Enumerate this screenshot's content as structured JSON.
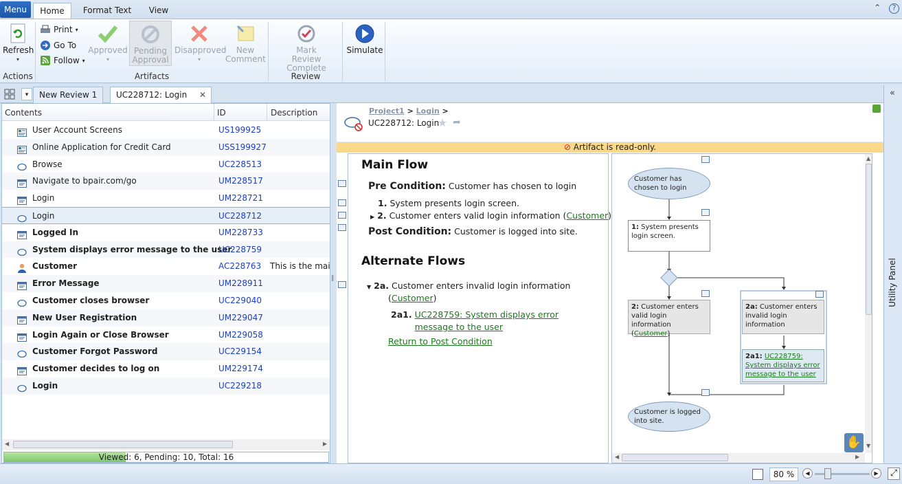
{
  "ribbon": {
    "menu_label": "Menu",
    "tabs": [
      "Home",
      "Format Text",
      "View"
    ],
    "actions": {
      "refresh": "Refresh",
      "group_label": "Actions"
    },
    "artifacts": {
      "print": "Print",
      "goto": "Go To",
      "follow": "Follow",
      "approved": "Approved",
      "pending_1": "Pending",
      "pending_2": "Approval",
      "disapproved": "Disapproved",
      "new_1": "New",
      "new_2": "Comment",
      "group_label": "Artifacts"
    },
    "review": {
      "mark_1": "Mark",
      "mark_2": "Review Complete",
      "group_label": "Review"
    },
    "simulate": "Simulate"
  },
  "doc_tabs": [
    {
      "label": "New Review 1"
    },
    {
      "label": "UC228712: Login"
    }
  ],
  "grid": {
    "headers": [
      "Contents",
      "ID",
      "Description"
    ],
    "rows": [
      {
        "icon": "storyboard-icon",
        "name": "User Account Screens",
        "id": "US199925",
        "desc": "",
        "bold": false
      },
      {
        "icon": "storyboard-icon",
        "name": "Online Application for Credit Card",
        "id": "USS199927",
        "desc": "",
        "bold": false
      },
      {
        "icon": "usecase-icon",
        "name": "Browse",
        "id": "UC228513",
        "desc": "",
        "bold": false
      },
      {
        "icon": "screen-icon",
        "name": "Navigate to bpair.com/go",
        "id": "UM228517",
        "desc": "",
        "bold": false
      },
      {
        "icon": "screen-icon",
        "name": "Login",
        "id": "UM228721",
        "desc": "",
        "bold": false
      },
      {
        "icon": "usecase-icon",
        "name": "Login",
        "id": "UC228712",
        "desc": "",
        "bold": false,
        "selected": true
      },
      {
        "icon": "screen-icon",
        "name": "Logged In",
        "id": "UM228733",
        "desc": "",
        "bold": true
      },
      {
        "icon": "usecase-icon",
        "name": "System displays error message to the user",
        "id": "UC228759",
        "desc": "",
        "bold": true
      },
      {
        "icon": "actor-icon",
        "name": "Customer",
        "id": "AC228763",
        "desc": "This is the main",
        "bold": true
      },
      {
        "icon": "screen-icon",
        "name": "Error Message",
        "id": "UM228911",
        "desc": "",
        "bold": true
      },
      {
        "icon": "usecase-icon",
        "name": "Customer closes browser",
        "id": "UC229040",
        "desc": "",
        "bold": true
      },
      {
        "icon": "screen-icon",
        "name": "New User Registration",
        "id": "UM229047",
        "desc": "",
        "bold": true
      },
      {
        "icon": "screen-icon",
        "name": "Login Again or Close Browser",
        "id": "UM229058",
        "desc": "",
        "bold": true
      },
      {
        "icon": "usecase-icon",
        "name": "Customer Forgot Password",
        "id": "UC229154",
        "desc": "",
        "bold": true
      },
      {
        "icon": "screen-icon",
        "name": "Customer decides to log on",
        "id": "UM229174",
        "desc": "",
        "bold": true
      },
      {
        "icon": "usecase-icon",
        "name": "Login",
        "id": "UC229218",
        "desc": "",
        "bold": true
      }
    ],
    "status": "Viewed: 6, Pending: 10, Total: 16",
    "viewed_fraction": 0.375
  },
  "artifact": {
    "breadcrumb": [
      "Project1",
      ">",
      "Login",
      ">"
    ],
    "title": "UC228712: Login",
    "readonly": "Artifact is read-only.",
    "main_flow_heading": "Main Flow",
    "pre_label": "Pre Condition:",
    "pre_text": "Customer has chosen to login",
    "step1_num": "1.",
    "step1": "System presents login screen.",
    "step2_num": "2.",
    "step2_text": "Customer enters valid login information (",
    "step2_link": "Customer",
    "step2_end": ")",
    "post_label": "Post Condition:",
    "post_text": "Customer is logged into site.",
    "alt_heading": "Alternate Flows",
    "alt_num": "2a.",
    "alt_text": "Customer enters invalid login information",
    "alt_open": "(",
    "alt_link": "Customer",
    "alt_close": ")",
    "alt_sub_num": "2a1.",
    "alt_sub_link": "UC228759: System displays error message to the user",
    "return_link": "Return to Post Condition"
  },
  "diagram": {
    "start": "Customer has chosen to login",
    "box1_num": "1:",
    "box1": "System presents login screen.",
    "box2_num": "2:",
    "box2": "Customer enters valid login information (",
    "box2_link": "Customer",
    "box2_end": ")",
    "box2a_num": "2a:",
    "box2a": "Customer enters invalid login information",
    "box2a1_num": "2a1:",
    "box2a1_link": "UC228759: System displays error message to the user",
    "end": "Customer is logged into site."
  },
  "utility_panel": "Utility Panel",
  "zoom": "80 %"
}
